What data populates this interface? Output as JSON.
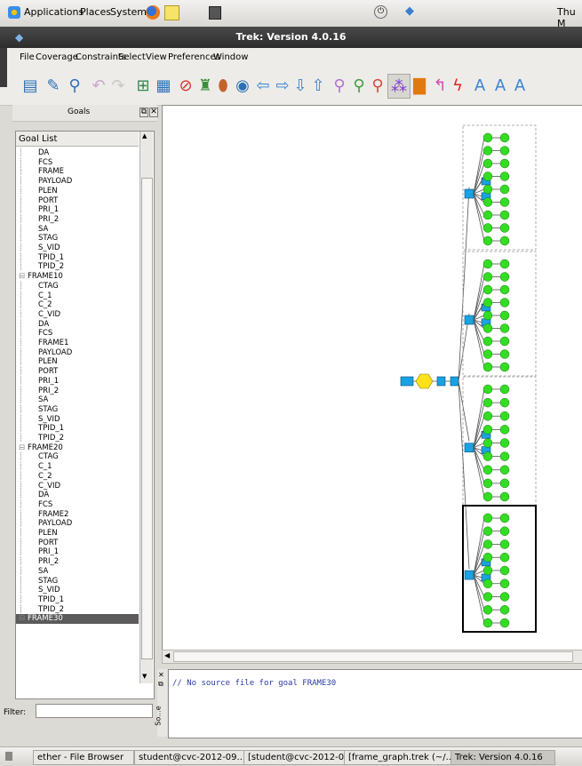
{
  "top_panel": {
    "menus": [
      "Applications",
      "Places",
      "System"
    ],
    "clock": "Thu M"
  },
  "window": {
    "title": "Trek: Version 4.0.16"
  },
  "menubar": [
    "File",
    "Coverage",
    "Constraints",
    "Select",
    "View",
    "Preferences",
    "Window"
  ],
  "dock": {
    "title": "Goals",
    "list_header": "Goal List",
    "filter_label": "Filter:",
    "filter_value": "",
    "items": [
      {
        "label": "DA",
        "level": 1
      },
      {
        "label": "FCS",
        "level": 1
      },
      {
        "label": "FRAME",
        "level": 1
      },
      {
        "label": "PAYLOAD",
        "level": 1
      },
      {
        "label": "PLEN",
        "level": 1
      },
      {
        "label": "PORT",
        "level": 1
      },
      {
        "label": "PRI_1",
        "level": 1
      },
      {
        "label": "PRI_2",
        "level": 1
      },
      {
        "label": "SA",
        "level": 1
      },
      {
        "label": "STAG",
        "level": 1
      },
      {
        "label": "S_VID",
        "level": 1
      },
      {
        "label": "TPID_1",
        "level": 1
      },
      {
        "label": "TPID_2",
        "level": 1
      },
      {
        "label": "FRAME10",
        "level": 0
      },
      {
        "label": "CTAG",
        "level": 1
      },
      {
        "label": "C_1",
        "level": 1
      },
      {
        "label": "C_2",
        "level": 1
      },
      {
        "label": "C_VID",
        "level": 1
      },
      {
        "label": "DA",
        "level": 1
      },
      {
        "label": "FCS",
        "level": 1
      },
      {
        "label": "FRAME1",
        "level": 1
      },
      {
        "label": "PAYLOAD",
        "level": 1
      },
      {
        "label": "PLEN",
        "level": 1
      },
      {
        "label": "PORT",
        "level": 1
      },
      {
        "label": "PRI_1",
        "level": 1
      },
      {
        "label": "PRI_2",
        "level": 1
      },
      {
        "label": "SA",
        "level": 1
      },
      {
        "label": "STAG",
        "level": 1
      },
      {
        "label": "S_VID",
        "level": 1
      },
      {
        "label": "TPID_1",
        "level": 1
      },
      {
        "label": "TPID_2",
        "level": 1
      },
      {
        "label": "FRAME20",
        "level": 0
      },
      {
        "label": "CTAG",
        "level": 1
      },
      {
        "label": "C_1",
        "level": 1
      },
      {
        "label": "C_2",
        "level": 1
      },
      {
        "label": "C_VID",
        "level": 1
      },
      {
        "label": "DA",
        "level": 1
      },
      {
        "label": "FCS",
        "level": 1
      },
      {
        "label": "FRAME2",
        "level": 1
      },
      {
        "label": "PAYLOAD",
        "level": 1
      },
      {
        "label": "PLEN",
        "level": 1
      },
      {
        "label": "PORT",
        "level": 1
      },
      {
        "label": "PRI_1",
        "level": 1
      },
      {
        "label": "PRI_2",
        "level": 1
      },
      {
        "label": "SA",
        "level": 1
      },
      {
        "label": "STAG",
        "level": 1
      },
      {
        "label": "S_VID",
        "level": 1
      },
      {
        "label": "TPID_1",
        "level": 1
      },
      {
        "label": "TPID_2",
        "level": 1
      },
      {
        "label": "FRAME30",
        "level": 0,
        "selected": true
      }
    ]
  },
  "source_pane": {
    "tab_label": "So...e",
    "text": "// No source file for goal FRAME30"
  },
  "taskbar": [
    "ether - File Browser",
    "student@cvc-2012-09...",
    "[student@cvc-2012-0...",
    "[frame_graph.trek (~/...",
    "Trek: Version 4.0.16"
  ],
  "colors": {
    "node_green": "#33dd22",
    "node_blue": "#19a3e0",
    "node_yellow": "#ffe21a",
    "titlebar": "#333333"
  }
}
